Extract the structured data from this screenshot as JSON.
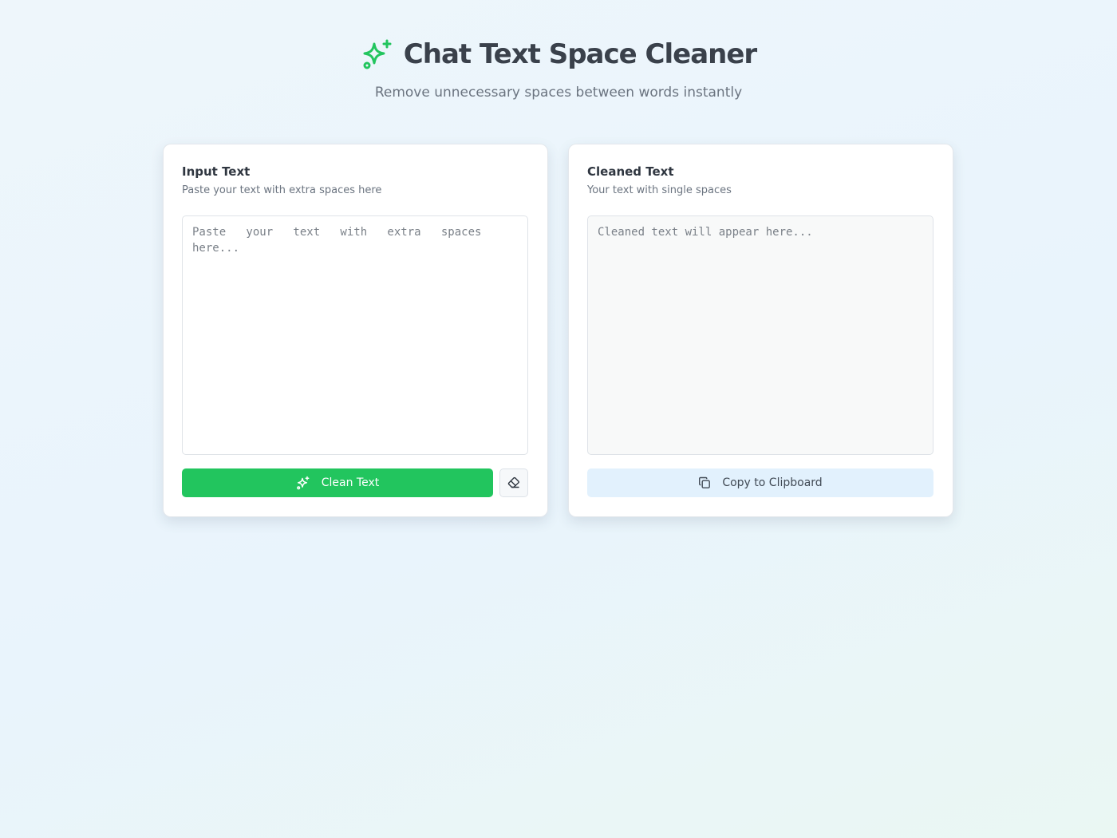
{
  "header": {
    "title": "Chat Text Space Cleaner",
    "subtitle": "Remove unnecessary spaces between words instantly",
    "icon": "sparkles-icon"
  },
  "input_card": {
    "title": "Input Text",
    "description": "Paste your text with extra spaces here",
    "textarea": {
      "value": "",
      "placeholder": "Paste   your   text   with   extra   spaces   here..."
    },
    "clean_button_label": "Clean Text",
    "clean_button_icon": "sparkles-icon",
    "clear_button_icon": "eraser-icon"
  },
  "output_card": {
    "title": "Cleaned Text",
    "description": "Your text with single spaces",
    "textarea": {
      "value": "",
      "placeholder": "Cleaned text will appear here..."
    },
    "copy_button_label": "Copy to Clipboard",
    "copy_button_icon": "copy-icon"
  },
  "colors": {
    "accent": "#22c55e",
    "copy_button_bg": "#e2f1fd",
    "title_text": "#3a414b"
  }
}
